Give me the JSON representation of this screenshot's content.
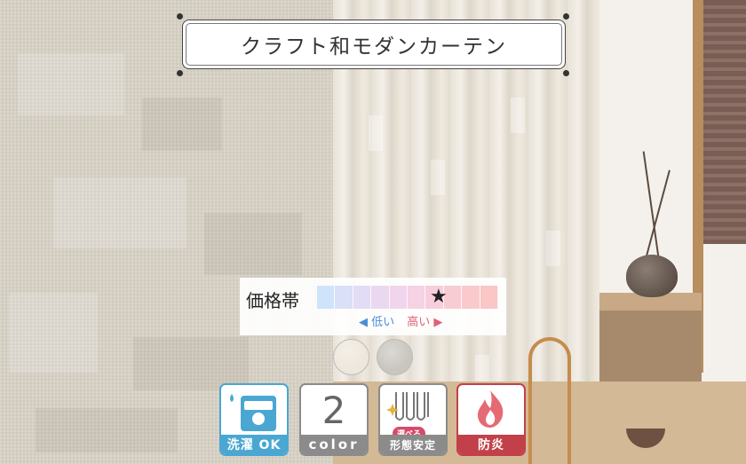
{
  "title": "クラフト和モダンカーテン",
  "price": {
    "label": "価格帯",
    "low": "◀ 低い",
    "high": "高い ▶",
    "cells": [
      "#cfe4fb",
      "#d9e0f8",
      "#e2dcf4",
      "#ead8f0",
      "#f1d5ec",
      "#f5d2e4",
      "#f7cfdc",
      "#f8ccd3",
      "#f9c9cc",
      "#fac6c6"
    ],
    "level_index": 6
  },
  "swatches": [
    "#eee7dc",
    "#c9c6bf"
  ],
  "features": {
    "wash": {
      "caption": "洗濯 OK",
      "icon": "washing-machine-icon"
    },
    "color": {
      "number": "2",
      "caption": "color"
    },
    "shape": {
      "badge": "選べる",
      "caption": "形態安定",
      "icon": "pleat-icon"
    },
    "fire": {
      "caption": "防炎",
      "icon": "flame-icon"
    }
  },
  "colors": {
    "wash": "#4aa7d2",
    "gray": "#8b8b8b",
    "fire": "#c2404a"
  }
}
